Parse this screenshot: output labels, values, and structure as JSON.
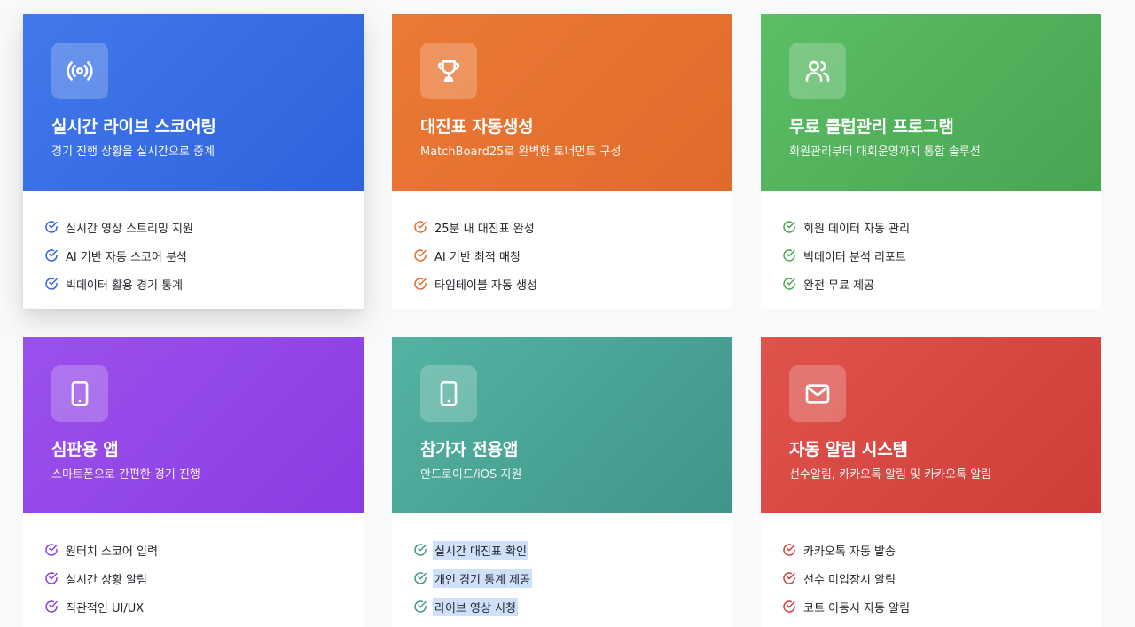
{
  "cards": [
    {
      "icon": "broadcast-icon",
      "title": "실시간 라이브 스코어링",
      "subtitle": "경기 진행 상황을 실시간으로 중계",
      "accent": "#2f62dd",
      "features": [
        "실시간 영상 스트리밍 지원",
        "AI 기반 자동 스코어 분석",
        "빅데이터 활용 경기 통계"
      ]
    },
    {
      "icon": "trophy-icon",
      "title": "대진표 자동생성",
      "subtitle": "MatchBoard25로 완벽한 토너먼트 구성",
      "accent": "#e06a2a",
      "features": [
        "25분 내 대진표 완성",
        "AI 기반 최적 매칭",
        "타임테이블 자동 생성"
      ]
    },
    {
      "icon": "users-icon",
      "title": "무료 클럽관리 프로그램",
      "subtitle": "회원관리부터 대회운영까지 통합 솔루션",
      "accent": "#48a552",
      "features": [
        "회원 데이터 자동 관리",
        "빅데이터 분석 리포트",
        "완전 무료 제공"
      ]
    },
    {
      "icon": "smartphone-icon",
      "title": "심판용 앱",
      "subtitle": "스마트폰으로 간편한 경기 진행",
      "accent": "#8a3de3",
      "features": [
        "원터치 스코어 입력",
        "실시간 상황 알림",
        "직관적인 UI/UX"
      ]
    },
    {
      "icon": "smartphone-icon",
      "title": "참가자 전용앱",
      "subtitle": "안드로이드/iOS 지원",
      "accent": "#3f9589",
      "features": [
        "실시간 대진표 확인",
        "개인 경기 통계 제공",
        "라이브 영상 시청"
      ]
    },
    {
      "icon": "mail-icon",
      "title": "자동 알림 시스템",
      "subtitle": "선수알림, 카카오톡 알림 및 카카오톡 알림",
      "accent": "#cf3d38",
      "features": [
        "카카오톡 자동 발송",
        "선수 미입장시 알림",
        "코트 이동시 자동 알림"
      ]
    }
  ]
}
